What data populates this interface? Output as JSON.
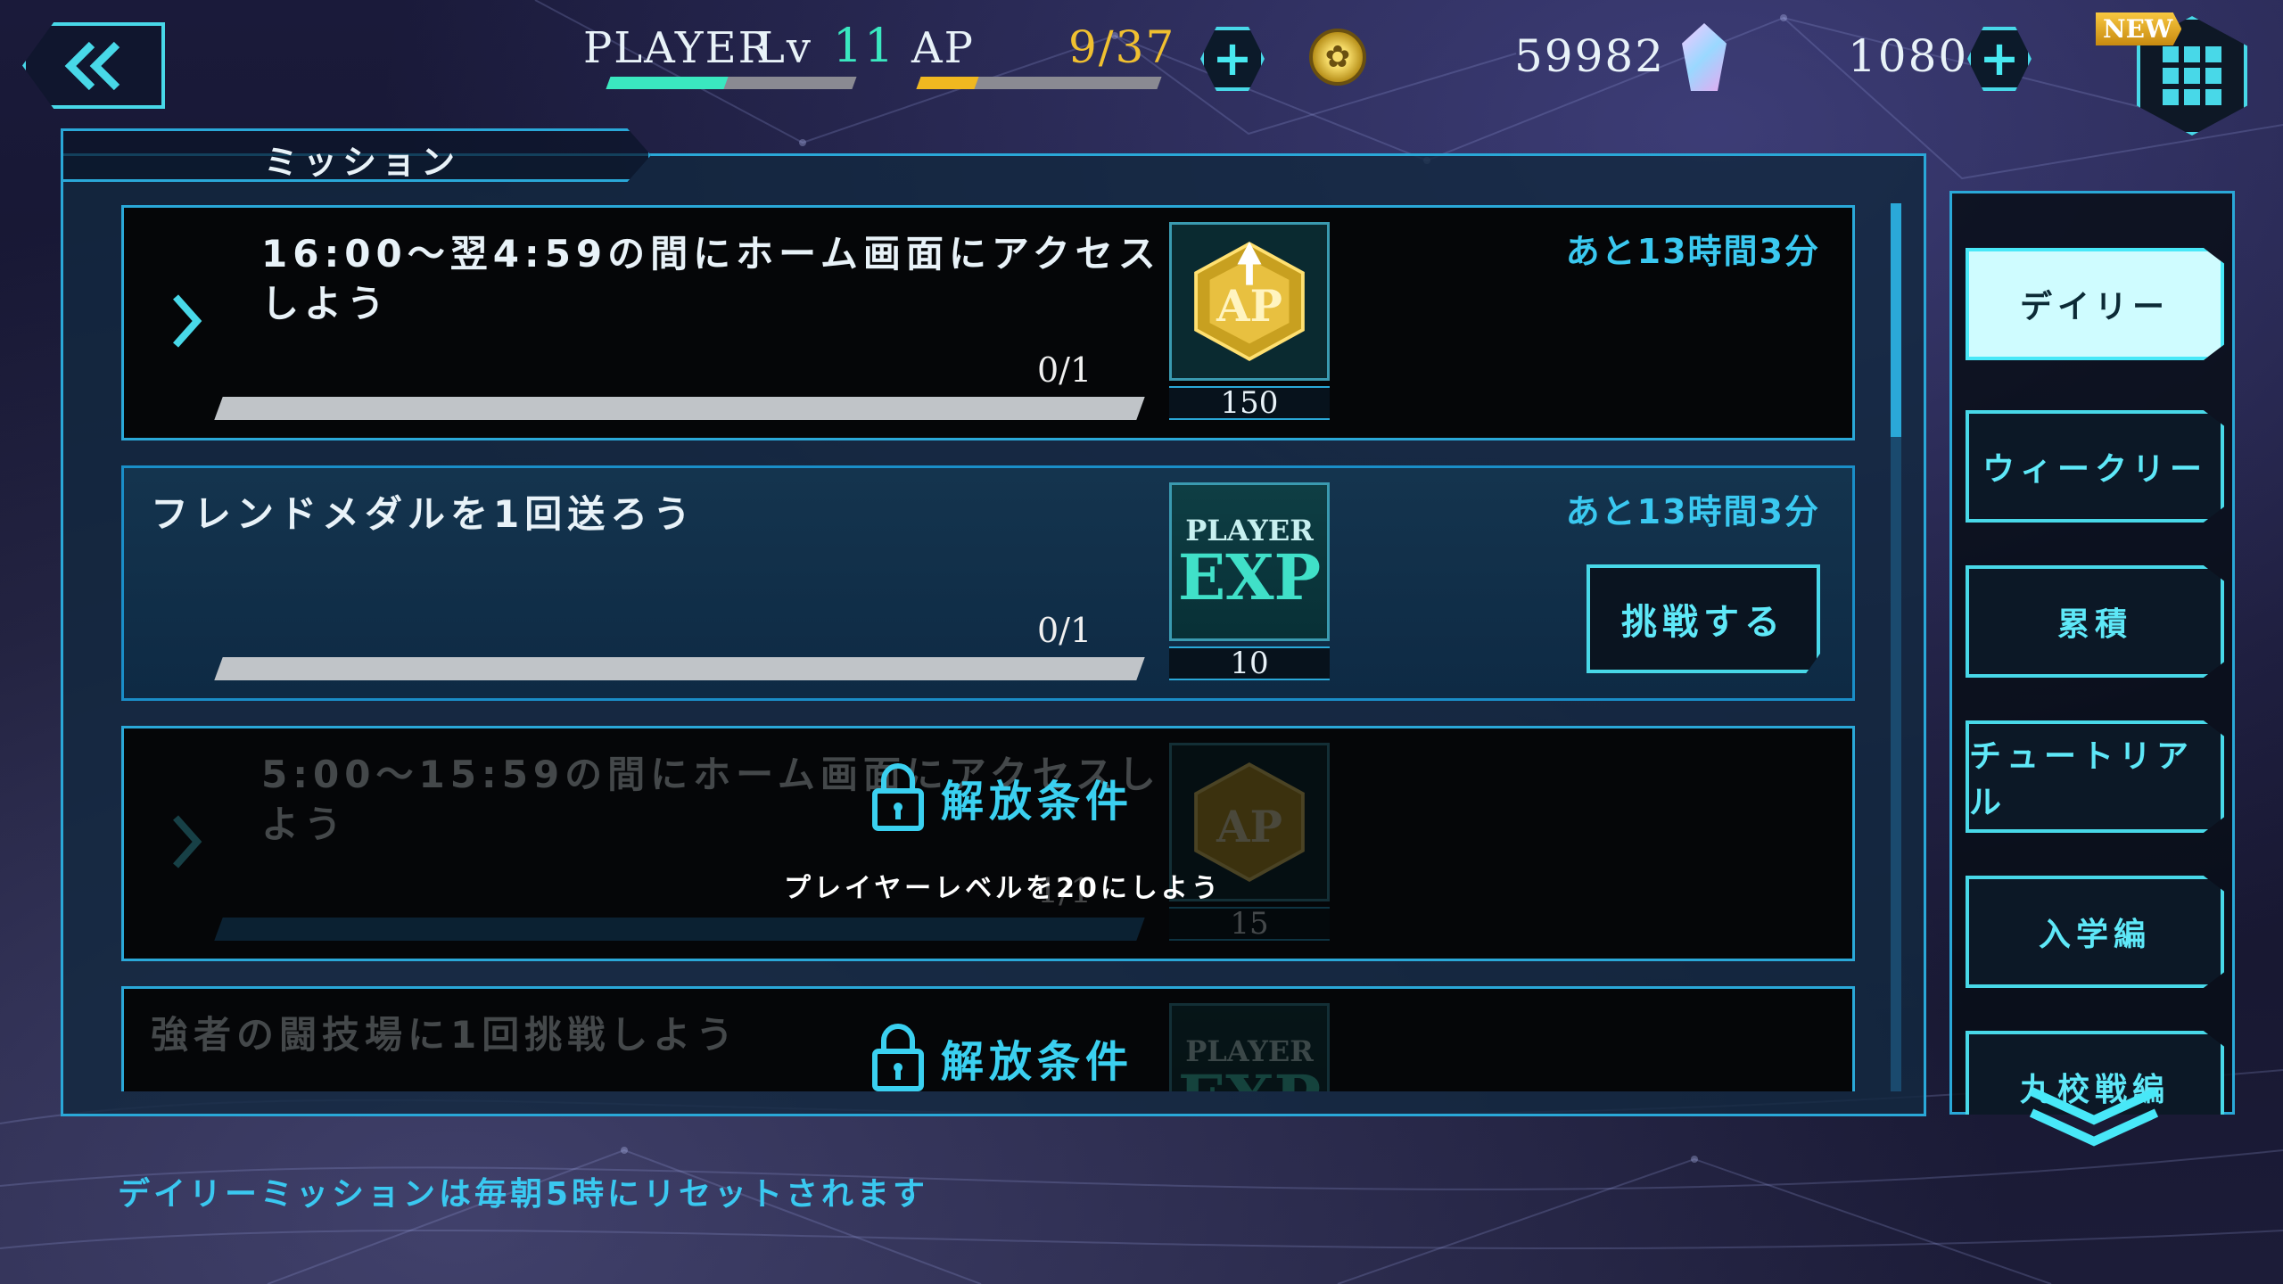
{
  "header": {
    "player_label": "PLAYER",
    "lv_label": "Lv",
    "level": "11",
    "ap_label": "AP",
    "ap_value": "9/37",
    "coins": "59982",
    "gems": "1080",
    "new_badge": "NEW",
    "level_progress": 0.48,
    "ap_progress": 0.24
  },
  "panel": {
    "title": "ミッション"
  },
  "missions": [
    {
      "title": "16:00～翌4:59の間にホーム画面にアクセスしよう",
      "progress": "0/1",
      "reward_icon": "ap-icon",
      "reward_amount": "150",
      "timer": "あと13時間3分",
      "state": "available"
    },
    {
      "title": "フレンドメダルを1回送ろう",
      "progress": "0/1",
      "reward_icon": "player-exp-icon",
      "reward_label_top": "PLAYER",
      "reward_label_bottom": "EXP",
      "reward_amount": "10",
      "timer": "あと13時間3分",
      "button": "挑戦する",
      "state": "active"
    },
    {
      "title": "5:00～15:59の間にホーム画面にアクセスしよう",
      "progress": "1/1",
      "reward_icon": "ap-icon",
      "reward_amount": "15",
      "state": "locked",
      "lock_label": "解放条件",
      "lock_condition": "プレイヤーレベルを20にしよう"
    },
    {
      "title": "強者の闘技場に1回挑戦しよう",
      "reward_icon": "player-exp-icon",
      "reward_label_top": "PLAYER",
      "reward_label_bottom": "EXP",
      "state": "locked",
      "lock_label": "解放条件"
    }
  ],
  "tabs": [
    {
      "label": "デイリー",
      "selected": true
    },
    {
      "label": "ウィークリー",
      "selected": false
    },
    {
      "label": "累積",
      "selected": false
    },
    {
      "label": "チュートリアル",
      "selected": false
    },
    {
      "label": "入学編",
      "selected": false
    },
    {
      "label": "九校戦編",
      "selected": false
    }
  ],
  "footer": "デイリーミッションは毎朝5時にリセットされます",
  "colors": {
    "accent": "#48d8e8",
    "level_bar": "#3ae8c0",
    "ap_bar": "#f0b820",
    "ap_text": "#f0c030",
    "level_text": "#3ae8c0",
    "timer_text": "#3ac8f0"
  }
}
